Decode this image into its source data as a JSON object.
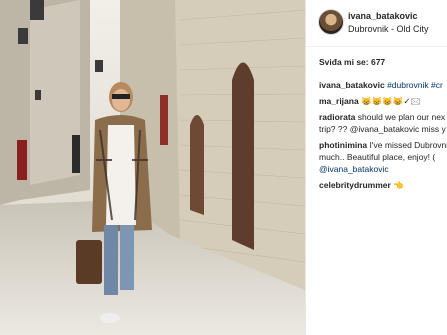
{
  "post": {
    "username": "ivana_batakovic",
    "location": "Dubrovnik - Old City",
    "likes": "Sviđa mi se: 677"
  },
  "comments": [
    {
      "user": "ivana_batakovic",
      "text": "#dubrovnik #cr"
    },
    {
      "user": "ma_rijana",
      "text": "😸😸😸😸✓🖂"
    },
    {
      "user": "radiorata",
      "text": "should we plan our nex",
      "line2": "trip? ?? @ivana_batakovic miss y"
    },
    {
      "user": "photinimina",
      "text": "I've missed Dubrovnik",
      "line2": "much.. Beautiful place, enjoy! (",
      "line3": "@ivana_batakovic"
    },
    {
      "user": "celebritydrummer",
      "text": "👈"
    }
  ]
}
